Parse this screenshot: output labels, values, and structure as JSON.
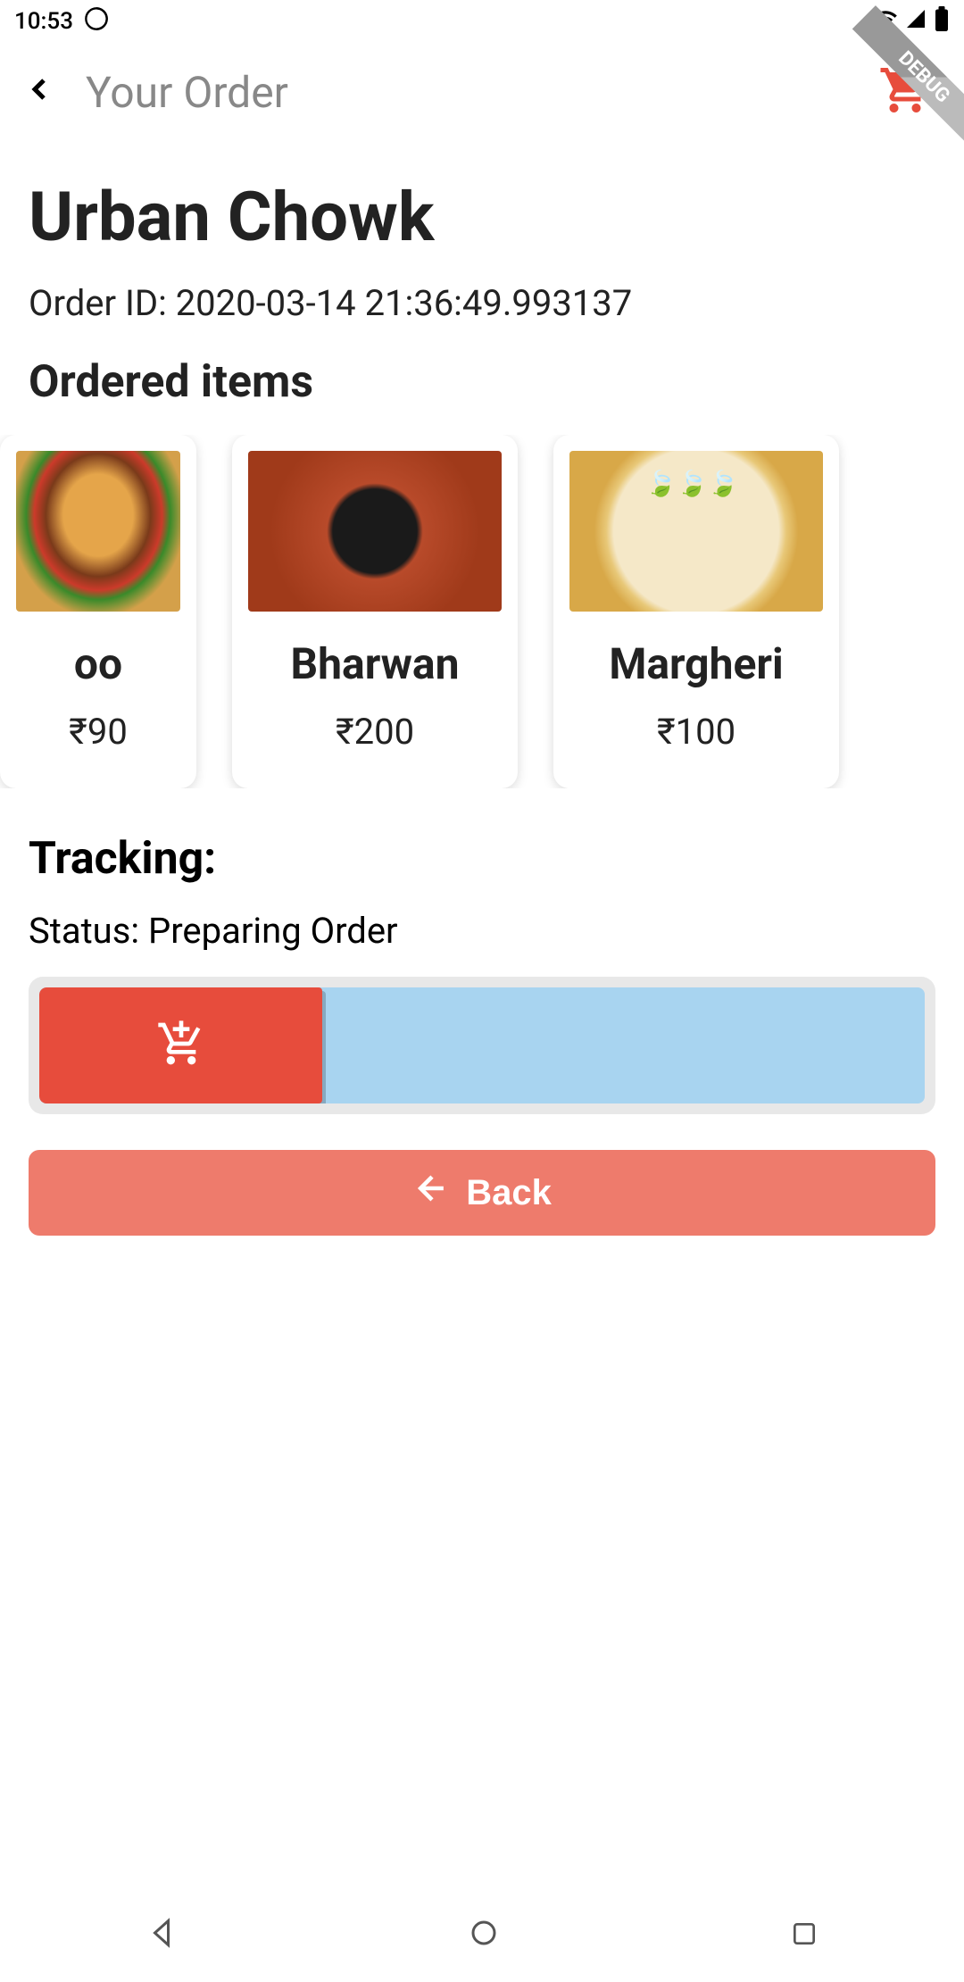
{
  "status_bar": {
    "time": "10:53"
  },
  "app_bar": {
    "title": "Your Order",
    "debug_label": "DEBUG"
  },
  "order": {
    "restaurant": "Urban Chowk",
    "order_id_label": "Order ID: 2020-03-14 21:36:49.993137",
    "items_heading": "Ordered items",
    "items": [
      {
        "name": "oo",
        "price": "₹90",
        "image": "burger"
      },
      {
        "name": "Bharwan",
        "price": "₹200",
        "image": "curry"
      },
      {
        "name": "Margheri",
        "price": "₹100",
        "image": "pizza"
      }
    ]
  },
  "tracking": {
    "heading": "Tracking:",
    "status": "Status: Preparing Order",
    "progress_percent": 32
  },
  "buttons": {
    "back": "Back"
  }
}
